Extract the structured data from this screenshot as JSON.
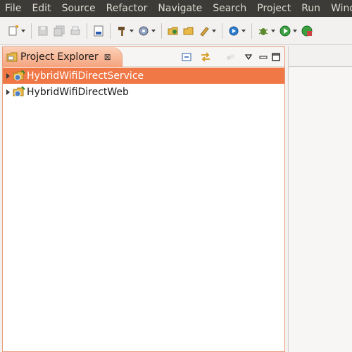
{
  "menu": [
    "File",
    "Edit",
    "Source",
    "Refactor",
    "Navigate",
    "Search",
    "Project",
    "Run",
    "Window"
  ],
  "toolbar": {
    "icons": [
      "new-icon",
      "save-icon",
      "save-all-icon",
      "print-icon",
      "binary-icon",
      "build-icon",
      "web-service-icon",
      "open-type-icon",
      "open-folder-icon",
      "mark-icon",
      "debug-icon",
      "bug-icon",
      "run-icon",
      "coverage-icon"
    ]
  },
  "explorer": {
    "tab_label": "Project Explorer",
    "close_glyph": "⊠",
    "projects": [
      {
        "name": "HybridWifiDirectService",
        "selected": true
      },
      {
        "name": "HybridWifiDirectWeb",
        "selected": false
      }
    ]
  },
  "colors": {
    "menubar_bg": "#3c3b37",
    "selection": "#f07746",
    "tab_active": "#f5a47e"
  }
}
